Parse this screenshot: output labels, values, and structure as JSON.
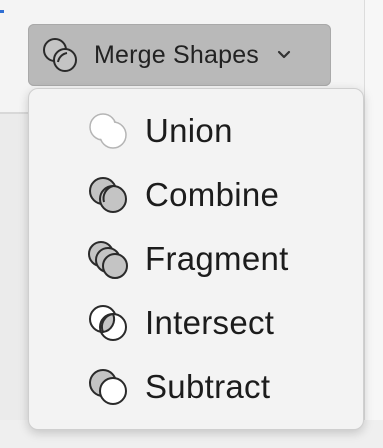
{
  "toolbar": {
    "merge_shapes": {
      "label": "Merge Shapes",
      "icon": "merge-shapes-icon"
    }
  },
  "menu": {
    "items": [
      {
        "label": "Union",
        "icon": "union-icon"
      },
      {
        "label": "Combine",
        "icon": "combine-icon"
      },
      {
        "label": "Fragment",
        "icon": "fragment-icon"
      },
      {
        "label": "Intersect",
        "icon": "intersect-icon"
      },
      {
        "label": "Subtract",
        "icon": "subtract-icon"
      }
    ]
  },
  "colors": {
    "button_bg": "#b9b9b9",
    "menu_bg": "#f3f3f3",
    "icon_fill": "#c4c4c4",
    "icon_stroke": "#2a2a2a"
  }
}
